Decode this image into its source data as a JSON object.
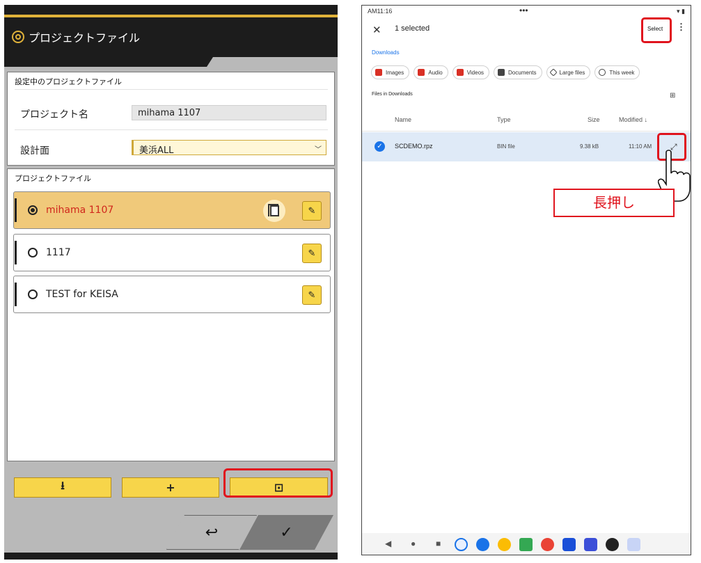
{
  "left": {
    "title": "プロジェクトファイル",
    "current_section": {
      "header": "設定中のプロジェクトファイル",
      "project_name_label": "プロジェクト名",
      "project_name_value": "mihama 1107",
      "design_surface_label": "設計面",
      "design_surface_value": "美浜ALL"
    },
    "files_section": {
      "header": "プロジェクトファイル",
      "items": [
        {
          "name": "mihama 1107",
          "selected": true
        },
        {
          "name": "1117",
          "selected": false
        },
        {
          "name": "TEST for KEISA",
          "selected": false
        }
      ]
    },
    "actions": {
      "import_icon": "⭳",
      "add_icon": "+",
      "folder_icon": "⊡"
    },
    "footer": {
      "back_icon": "↩",
      "ok_icon": "✓"
    },
    "colors": {
      "accent": "#f7d54a",
      "selected_row": "#f0c97a",
      "selected_text": "#d0261c",
      "highlight": "#e0141e"
    }
  },
  "right": {
    "status": {
      "time": "AM11:16",
      "dots": "•••"
    },
    "topbar": {
      "close": "✕",
      "selected_count": "1 selected",
      "select_label": "Select",
      "more": "⋮"
    },
    "breadcrumb": "Downloads",
    "chips": [
      "Images",
      "Audio",
      "Videos",
      "Documents",
      "Large files",
      "This week"
    ],
    "files_in": "Files in Downloads",
    "columns": {
      "name": "Name",
      "type": "Type",
      "size": "Size",
      "modified": "Modified ↓"
    },
    "file": {
      "name": "SCDEMO.rpz",
      "type": "BIN file",
      "size": "9.38 kB",
      "modified": "11:10 AM"
    },
    "annotation": "長押し",
    "nav": {
      "back": "◀",
      "home": "●",
      "recents": "■"
    }
  }
}
